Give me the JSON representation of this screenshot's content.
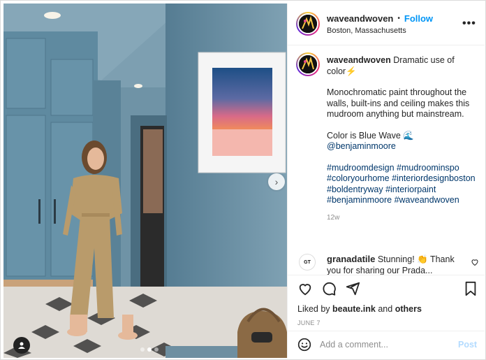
{
  "post": {
    "username": "waveandwoven",
    "follow_label": "Follow",
    "separator": "•",
    "location": "Boston, Massachusetts",
    "more_label": "•••"
  },
  "caption": {
    "username": "waveandwoven",
    "line1": "Dramatic use of color⚡",
    "para2": "Monochromatic paint throughout the walls, built-ins and ceiling makes this mudroom anything but mainstream.",
    "para3_text": "Color is Blue Wave 🌊",
    "para3_mention": "@benjaminmoore",
    "hashtags": "#mudroomdesign #mudroominspo #coloryourhome #interiordesignboston #boldentryway #interiorpaint #benjaminmoore #waveandwoven",
    "age": "12w"
  },
  "comment": {
    "username": "granadatile",
    "text": "Stunning! 👏 Thank you for sharing our Prada..."
  },
  "likes": {
    "prefix": "Liked by",
    "user": "beaute.ink",
    "connector": "and",
    "others": "others"
  },
  "date": "JUNE 7",
  "add_comment": {
    "placeholder": "Add a comment...",
    "post_label": "Post"
  },
  "carousel": {
    "next_icon": "chevron-right-icon",
    "dot_count": 3,
    "active_dot": 1
  },
  "colors": {
    "accent": "#0095f6",
    "link": "#00376b",
    "wall": "#6f93a6"
  }
}
